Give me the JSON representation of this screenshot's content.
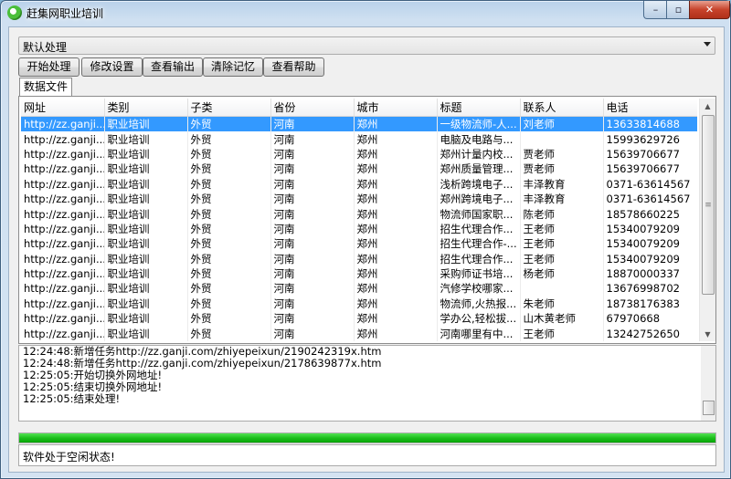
{
  "window": {
    "title": "赶集网职业培训"
  },
  "controls": {
    "minimize": "–",
    "maximize": "▫",
    "close": "✕"
  },
  "mode_select": {
    "value": "默认处理"
  },
  "toolbar": {
    "buttons": [
      "开始处理",
      "修改设置",
      "查看输出",
      "清除记忆",
      "查看帮助"
    ]
  },
  "tabs": [
    "数据文件"
  ],
  "table": {
    "columns": [
      "网址",
      "类别",
      "子类",
      "省份",
      "城市",
      "标题",
      "联系人",
      "电话"
    ],
    "selected_row": 0,
    "rows": [
      [
        "http://zz.ganji...",
        "职业培训",
        "外贸",
        "河南",
        "郑州",
        "一级物流师-人...",
        "刘老师",
        "13633814688"
      ],
      [
        "http://zz.ganji...",
        "职业培训",
        "外贸",
        "河南",
        "郑州",
        "电脑及电路与...",
        "",
        "15993629726"
      ],
      [
        "http://zz.ganji...",
        "职业培训",
        "外贸",
        "河南",
        "郑州",
        "郑州计量内校...",
        "贾老师",
        "15639706677"
      ],
      [
        "http://zz.ganji...",
        "职业培训",
        "外贸",
        "河南",
        "郑州",
        "郑州质量管理...",
        "贾老师",
        "15639706677"
      ],
      [
        "http://zz.ganji...",
        "职业培训",
        "外贸",
        "河南",
        "郑州",
        "浅析跨境电子...",
        "丰泽教育",
        "0371-63614567"
      ],
      [
        "http://zz.ganji...",
        "职业培训",
        "外贸",
        "河南",
        "郑州",
        "郑州跨境电子...",
        "丰泽教育",
        "0371-63614567"
      ],
      [
        "http://zz.ganji...",
        "职业培训",
        "外贸",
        "河南",
        "郑州",
        "物流师国家职...",
        "陈老师",
        "18578660225"
      ],
      [
        "http://zz.ganji...",
        "职业培训",
        "外贸",
        "河南",
        "郑州",
        "招生代理合作...",
        "王老师",
        "15340079209"
      ],
      [
        "http://zz.ganji...",
        "职业培训",
        "外贸",
        "河南",
        "郑州",
        "招生代理合作-...",
        "王老师",
        "15340079209"
      ],
      [
        "http://zz.ganji...",
        "职业培训",
        "外贸",
        "河南",
        "郑州",
        "招生代理合作...",
        "王老师",
        "15340079209"
      ],
      [
        "http://zz.ganji...",
        "职业培训",
        "外贸",
        "河南",
        "郑州",
        "采购师证书培...",
        "杨老师",
        "18870000337"
      ],
      [
        "http://zz.ganji...",
        "职业培训",
        "外贸",
        "河南",
        "郑州",
        "汽修学校哪家...",
        "",
        "13676998702"
      ],
      [
        "http://zz.ganji...",
        "职业培训",
        "外贸",
        "河南",
        "郑州",
        "物流师,火热报...",
        "朱老师",
        "18738176383"
      ],
      [
        "http://zz.ganji...",
        "职业培训",
        "外贸",
        "河南",
        "郑州",
        "学办公,轻松拔...",
        "山木黄老师",
        "67970668"
      ],
      [
        "http://zz.ganji...",
        "职业培训",
        "外贸",
        "河南",
        "郑州",
        "河南哪里有中...",
        "王老师",
        "13242752650"
      ]
    ]
  },
  "log": {
    "lines": [
      "12:24:48:新增任务http://zz.ganji.com/zhiyepeixun/2190242319x.htm",
      "12:24:48:新增任务http://zz.ganji.com/zhiyepeixun/2178639877x.htm",
      "12:25:05:开始切换外网地址!",
      "12:25:05:结束切换外网地址!",
      "12:25:05:结束处理!"
    ]
  },
  "progress": {
    "percent": 100
  },
  "status": {
    "text": "软件处于空闲状态!"
  }
}
